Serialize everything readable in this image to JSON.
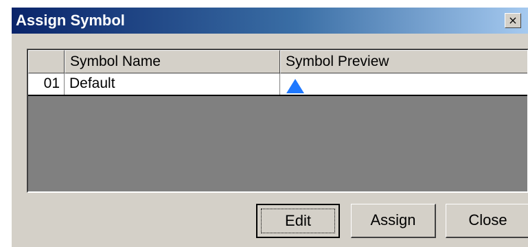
{
  "window": {
    "title": "Assign Symbol",
    "close_glyph": "×"
  },
  "grid": {
    "columns": [
      "",
      "Symbol Name",
      "Symbol Preview"
    ],
    "rows": [
      {
        "index": "01",
        "name": "Default",
        "preview": "blue-triangle-up",
        "preview_color": "#1e78ff"
      }
    ]
  },
  "buttons": {
    "edit": "Edit",
    "assign": "Assign",
    "close": "Close"
  },
  "colors": {
    "title_gradient_start": "#0a246a",
    "title_gradient_end": "#a6caf0",
    "dialog_face": "#d4d0c8",
    "grid_empty": "#808080"
  }
}
